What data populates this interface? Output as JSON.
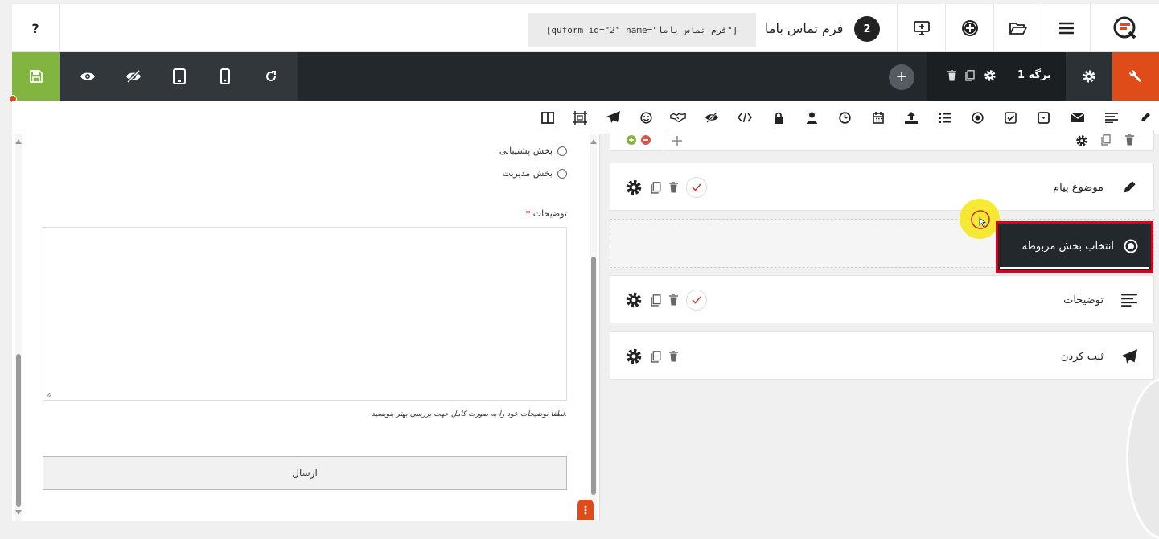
{
  "topbar": {
    "help_label": "?",
    "shortcode": "[quform id=\"2\" name=\"فرم تماس باما\"]",
    "form_title": "فرم تماس باما",
    "form_id": "2"
  },
  "toolbar": {
    "page_label": "برگه 1",
    "add_page": "+"
  },
  "element_icons": [
    "pencil-icon",
    "align-left-icon",
    "envelope-icon",
    "caret-square-icon",
    "check-square-icon",
    "radio-icon",
    "list-icon",
    "upload-icon",
    "calendar-icon",
    "clock-icon",
    "user-icon",
    "lock-icon",
    "code-icon",
    "eye-slash-icon",
    "handshake-icon",
    "smile-icon",
    "paper-plane-icon",
    "crop-icon",
    "columns-icon"
  ],
  "preview": {
    "radio_options": [
      "بخش پشتیبانی",
      "بخش مدیریت"
    ],
    "desc_label": "توضیحات",
    "desc_required": "*",
    "desc_help": "لطفا توضیحات خود را به صورت کامل جهت بررسی بهتر بنویسید.",
    "submit_label": "ارسال"
  },
  "builder": {
    "fields": [
      {
        "label": "موضوع پیام",
        "icon": "pencil-icon"
      },
      {
        "label": "توضیحات",
        "icon": "align-left-icon"
      },
      {
        "label": "ثبت کردن",
        "icon": "paper-plane-icon"
      }
    ],
    "dragging": {
      "label": "انتخاب بخش مربوطه",
      "icon": "radio-icon"
    }
  },
  "colors": {
    "dark": "#23282d",
    "save": "#82b540",
    "tools": "#e04b1a",
    "highlight_border": "#e0001b",
    "cursor": "#f5e614"
  }
}
